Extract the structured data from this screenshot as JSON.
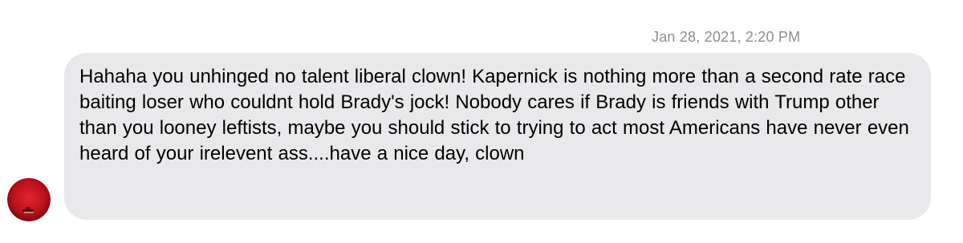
{
  "conversation": {
    "timestamp": "Jan 28, 2021, 2:20 PM",
    "message": {
      "text": "Hahaha you unhinged no talent liberal clown! Kapernick is nothing more than a second rate race baiting loser who couldnt hold Brady's jock! Nobody cares if Brady is friends with Trump other than you looney leftists, maybe you should stick to trying to act most Americans have never even heard of your irelevent ass....have a nice day, clown",
      "bubble_color": "#e9e9eb",
      "text_color": "#000000"
    },
    "avatar": {
      "icon": "red-circle-avatar-icon",
      "color": "#c00d16"
    },
    "timestamp_color": "#8e8e93"
  }
}
